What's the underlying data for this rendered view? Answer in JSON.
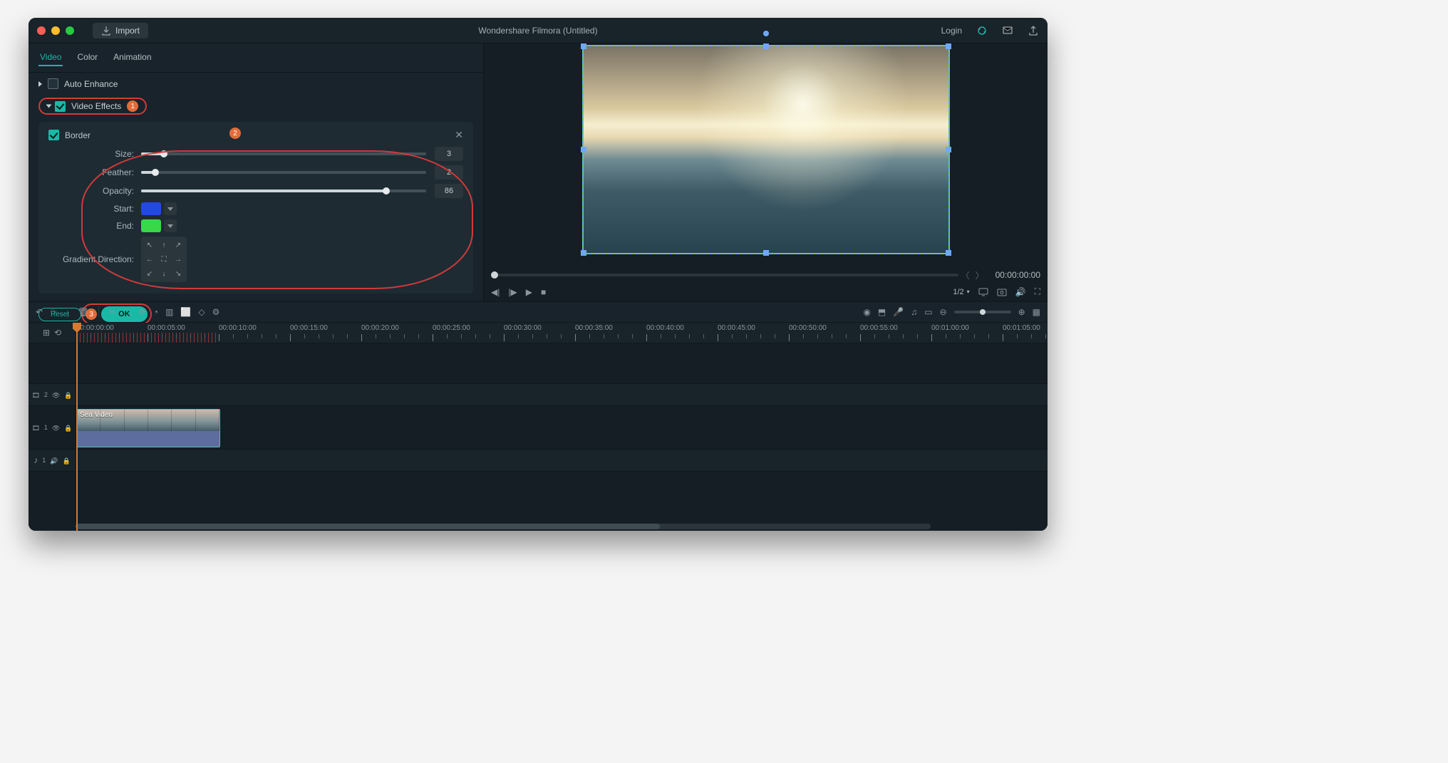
{
  "app": {
    "import_label": "Import",
    "title": "Wondershare Filmora (Untitled)",
    "login_label": "Login"
  },
  "tabs": {
    "video": "Video",
    "color": "Color",
    "animation": "Animation"
  },
  "sections": {
    "auto_enhance": "Auto Enhance",
    "video_effects": "Video Effects"
  },
  "annotations": {
    "n1": "1",
    "n2": "2",
    "n3": "3"
  },
  "border": {
    "heading": "Border",
    "size_label": "Size:",
    "size_value": "3",
    "size_pct": 8,
    "feather_label": "Feather:",
    "feather_value": "2",
    "feather_pct": 5,
    "opacity_label": "Opacity:",
    "opacity_value": "86",
    "opacity_pct": 86,
    "start_label": "Start:",
    "start_color": "#2248e6",
    "end_label": "End:",
    "end_color": "#39d84a",
    "gradient_label": "Gradient Direction:"
  },
  "footer": {
    "reset_label": "Reset",
    "ok_label": "OK"
  },
  "preview": {
    "timecode": "00:00:00:00",
    "zoom_label": "1/2"
  },
  "ruler_labels": [
    "00:00:00:00",
    "00:00:05:00",
    "00:00:10:00",
    "00:00:15:00",
    "00:00:20:00",
    "00:00:25:00",
    "00:00:30:00",
    "00:00:35:00",
    "00:00:40:00",
    "00:00:45:00",
    "00:00:50:00",
    "00:00:55:00",
    "00:01:00:00",
    "00:01:05:00"
  ],
  "tracks": {
    "t2": "2",
    "t1": "1",
    "a1": "1"
  },
  "clip": {
    "name": "Sea Video"
  }
}
